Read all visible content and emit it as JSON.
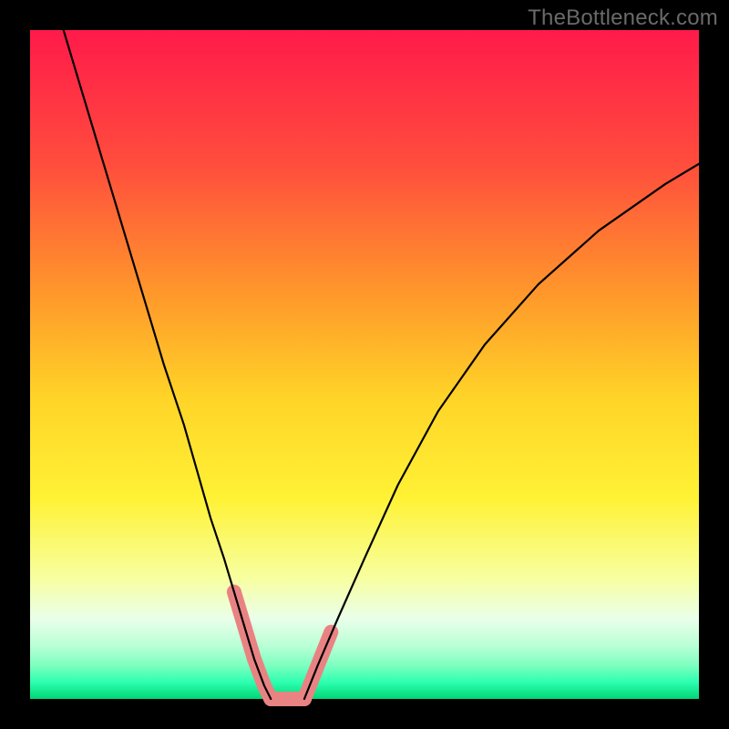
{
  "watermark": "TheBottleneck.com",
  "chart_data": {
    "type": "line",
    "title": "",
    "xlabel": "",
    "ylabel": "",
    "xlim": [
      0,
      100
    ],
    "ylim": [
      0,
      100
    ],
    "gradient_stops": [
      {
        "offset": 0.0,
        "color": "#ff1a4a"
      },
      {
        "offset": 0.2,
        "color": "#ff4d3d"
      },
      {
        "offset": 0.4,
        "color": "#ff9a2a"
      },
      {
        "offset": 0.55,
        "color": "#ffd428"
      },
      {
        "offset": 0.7,
        "color": "#fff235"
      },
      {
        "offset": 0.82,
        "color": "#f7ffa0"
      },
      {
        "offset": 0.88,
        "color": "#eaffea"
      },
      {
        "offset": 0.92,
        "color": "#baffd6"
      },
      {
        "offset": 0.95,
        "color": "#7dffc0"
      },
      {
        "offset": 0.975,
        "color": "#2dffb0"
      },
      {
        "offset": 1.0,
        "color": "#00d675"
      }
    ],
    "series": [
      {
        "name": "left-curve",
        "x": [
          5,
          8,
          11,
          14,
          17,
          20,
          23,
          25,
          27,
          29,
          30.5,
          32,
          33.5,
          35,
          36
        ],
        "y": [
          100,
          90,
          80,
          70,
          60,
          50,
          41,
          34,
          27,
          21,
          16,
          11,
          6,
          2,
          0
        ]
      },
      {
        "name": "right-curve",
        "x": [
          41,
          43,
          46,
          50,
          55,
          61,
          68,
          76,
          85,
          95,
          100
        ],
        "y": [
          0,
          5,
          12,
          21,
          32,
          43,
          53,
          62,
          70,
          77,
          80
        ]
      }
    ],
    "highlights": [
      {
        "name": "left-highlight-segment",
        "x": [
          30.5,
          32,
          33.5,
          35,
          36
        ],
        "y": [
          16,
          11,
          6,
          2,
          0
        ]
      },
      {
        "name": "valley-floor",
        "x": [
          36,
          37.5,
          39,
          40,
          41
        ],
        "y": [
          0,
          0,
          0,
          0,
          0
        ]
      },
      {
        "name": "right-highlight-segment",
        "x": [
          41,
          43,
          45
        ],
        "y": [
          0,
          5,
          10
        ]
      }
    ],
    "highlight_color": "#e98383",
    "line_color": "#000000"
  }
}
